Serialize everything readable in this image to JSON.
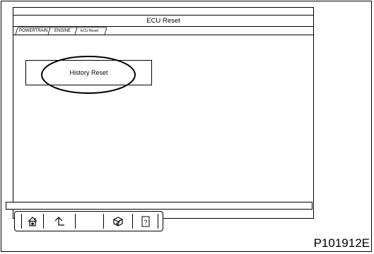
{
  "window": {
    "title": "ECU Reset"
  },
  "breadcrumb": {
    "items": [
      {
        "label": "POWERTRAIN"
      },
      {
        "label": "ENGINE"
      },
      {
        "label": "ECU Reset"
      }
    ]
  },
  "main": {
    "history_reset_label": "History Reset"
  },
  "toolbar": {
    "buttons": [
      {
        "icon": "home-icon"
      },
      {
        "icon": "back-icon"
      },
      {
        "icon": "blank"
      },
      {
        "icon": "print-icon"
      },
      {
        "icon": "help-icon"
      }
    ]
  },
  "figure": {
    "part_number": "P101912E"
  }
}
